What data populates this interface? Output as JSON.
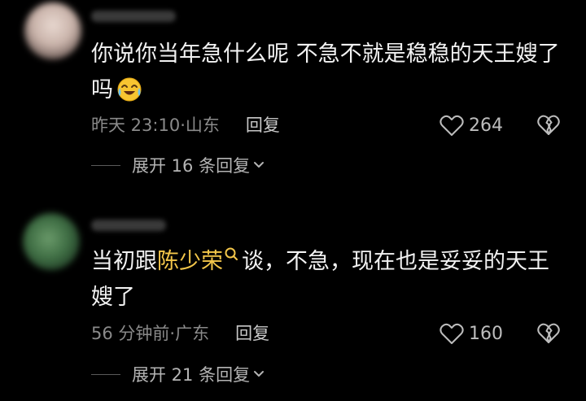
{
  "comments": [
    {
      "text_line1": "你说你当年急什么呢 不急不就是稳稳的天王嫂了",
      "text_line2": "吗",
      "time": "昨天 23:10",
      "location": "山东",
      "reply_label": "回复",
      "like_count": "264",
      "expand_label": "展开 16 条回复"
    },
    {
      "text_prefix": "当初跟",
      "mention": "陈少荣",
      "text_suffix": "谈，不急，现在也是妥妥的天王",
      "text_line2": "嫂了",
      "time": "56 分钟前",
      "location": "广东",
      "reply_label": "回复",
      "like_count": "160",
      "expand_label": "展开 21 条回复"
    }
  ],
  "icons": {
    "like": "heart-outline-icon",
    "dislike": "broken-heart-icon",
    "emoji": "crying-laughing-emoji",
    "expand": "chevron-down-icon",
    "mention_search": "search-icon"
  },
  "colors": {
    "background": "#000000",
    "text": "#f2f2f2",
    "meta": "#8a8a8a",
    "mention": "#f3c64a"
  }
}
